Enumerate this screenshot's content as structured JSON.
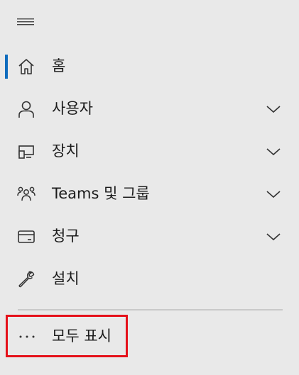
{
  "menu": {
    "toggle_icon": "hamburger-icon"
  },
  "nav": {
    "items": [
      {
        "label": "홈",
        "icon": "home-icon",
        "selected": true,
        "expandable": false
      },
      {
        "label": "사용자",
        "icon": "person-icon",
        "selected": false,
        "expandable": true
      },
      {
        "label": "장치",
        "icon": "device-icon",
        "selected": false,
        "expandable": true
      },
      {
        "label": "Teams 및 그룹",
        "icon": "people-team-icon",
        "selected": false,
        "expandable": true
      },
      {
        "label": "청구",
        "icon": "credit-card-icon",
        "selected": false,
        "expandable": true
      },
      {
        "label": "설치",
        "icon": "wrench-icon",
        "selected": false,
        "expandable": false
      }
    ],
    "show_all": {
      "label": "모두 표시",
      "icon": "more-icon"
    }
  },
  "colors": {
    "background": "#e9e9e9",
    "selection_accent": "#0f6cbd",
    "highlight_border": "#e5111a",
    "divider": "#c9c9c9"
  }
}
